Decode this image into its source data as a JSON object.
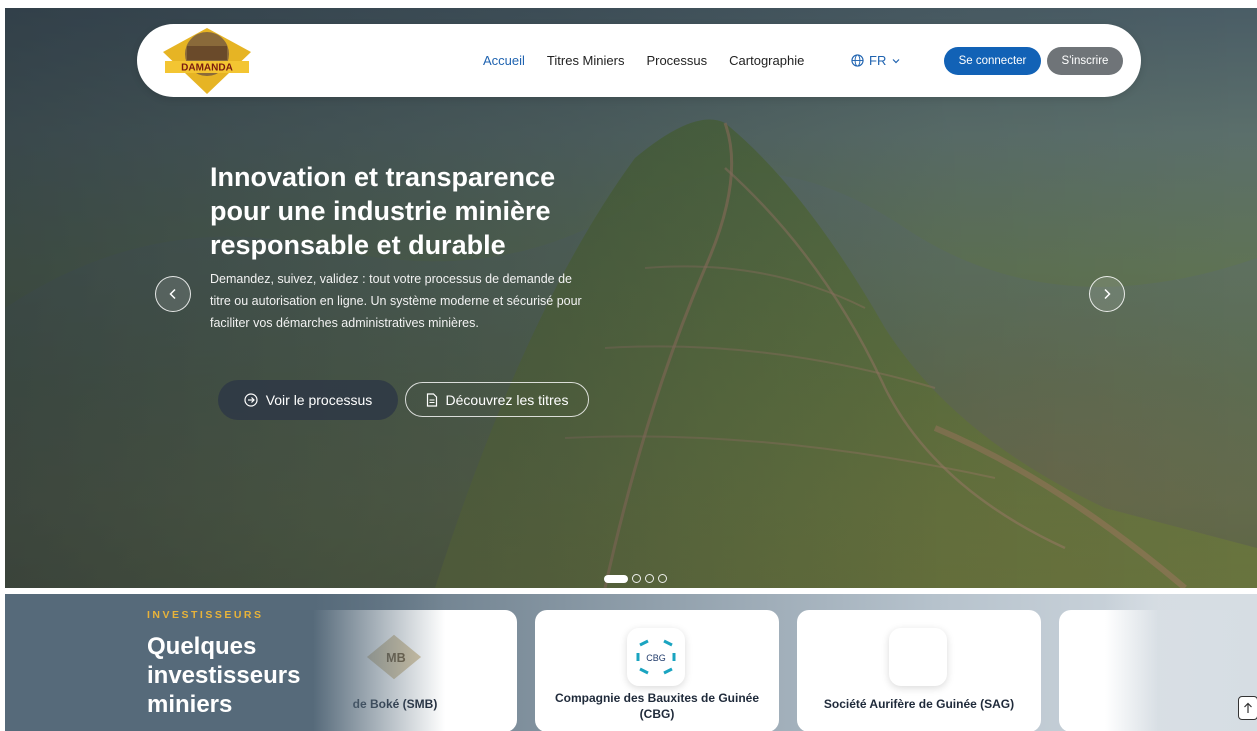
{
  "nav": {
    "logo_text": "DAMANDA",
    "links": [
      "Accueil",
      "Titres Miniers",
      "Processus",
      "Cartographie"
    ],
    "lang": "FR",
    "login": "Se connecter",
    "signup": "S'inscrire"
  },
  "hero": {
    "title_lines": [
      "Innovation et transparence",
      "pour une industrie minière",
      "responsable et durable"
    ],
    "desc_lines": [
      "Demandez, suivez, validez : tout votre processus de demande de",
      "titre ou autorisation en ligne. Un système moderne et sécurisé pour",
      "faciliter vos démarches administratives minières."
    ],
    "btn_process": "Voir le processus",
    "btn_titles": "Découvrez les titres",
    "slides_total": 4,
    "slide_active": 1
  },
  "investors": {
    "eyebrow": "INVESTISSEURS",
    "title_lines": [
      "Quelques",
      "investisseurs",
      "miniers"
    ],
    "cards": [
      {
        "name": "de Boké (SMB)",
        "logo_text": "MB"
      },
      {
        "name": "Compagnie des Bauxites de Guinée (CBG)",
        "logo_text": "CBG"
      },
      {
        "name": "Société Aurifère de Guinée (SAG)",
        "logo_text": ""
      },
      {
        "name": "",
        "logo_text": ""
      }
    ]
  },
  "colors": {
    "primary": "#1262b6",
    "accent": "#e8b33a",
    "secondary_button": "#6f7478"
  },
  "icons": [
    "globe-icon",
    "chevron-down-icon",
    "chevron-left-icon",
    "chevron-right-icon",
    "arrow-circle-right-icon",
    "document-icon",
    "arrow-up-icon"
  ]
}
